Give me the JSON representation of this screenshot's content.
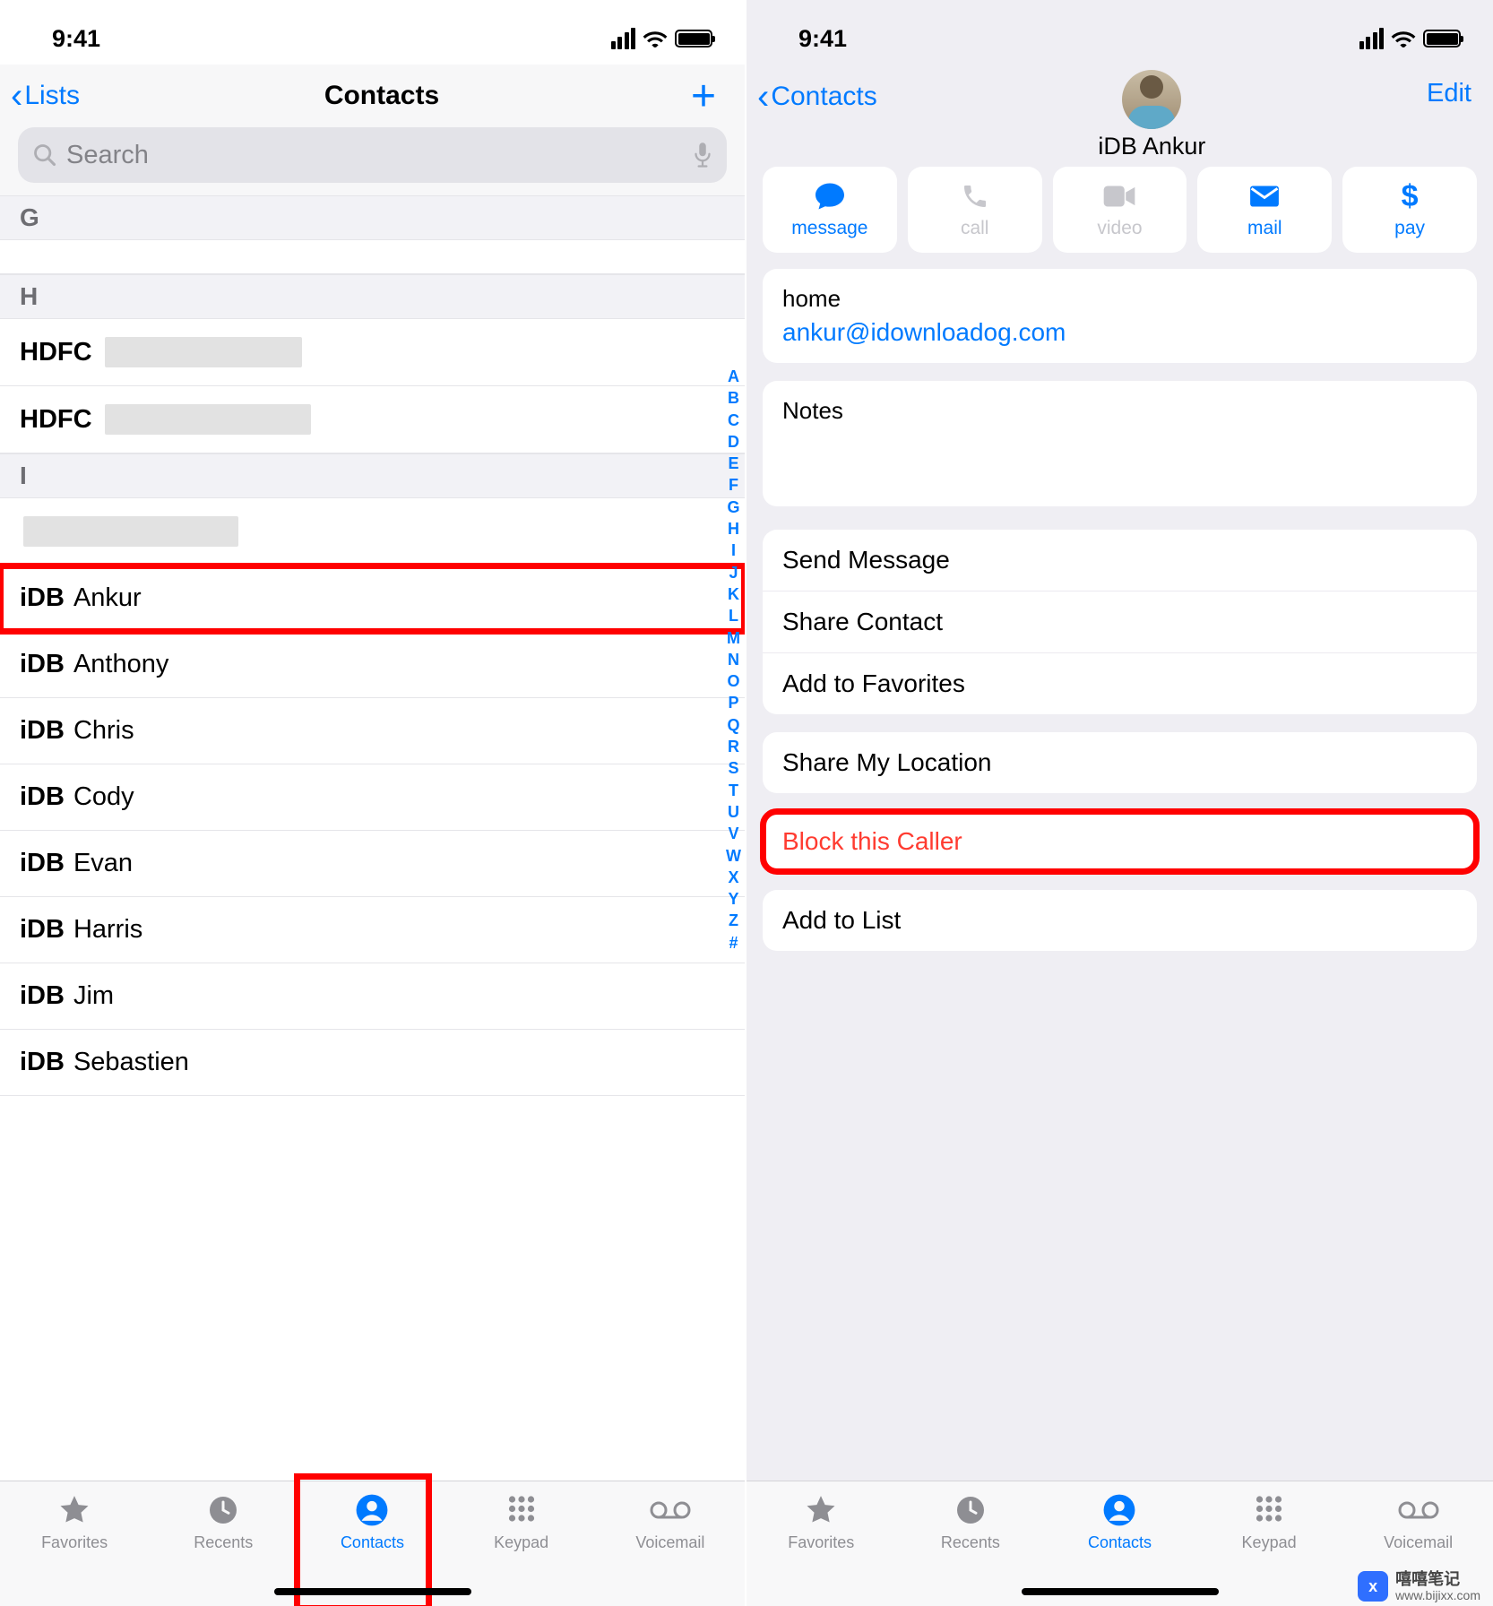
{
  "status": {
    "time": "9:41"
  },
  "left": {
    "back_label": "Lists",
    "title": "Contacts",
    "search_placeholder": "Search",
    "sections": {
      "g": "G",
      "h": "H",
      "i": "I"
    },
    "contacts": [
      {
        "bold": "HDFC",
        "rest": ""
      },
      {
        "bold": "HDFC",
        "rest": ""
      },
      {
        "bold": "iDB",
        "rest": "Ankur"
      },
      {
        "bold": "iDB",
        "rest": "Anthony"
      },
      {
        "bold": "iDB",
        "rest": "Chris"
      },
      {
        "bold": "iDB",
        "rest": "Cody"
      },
      {
        "bold": "iDB",
        "rest": "Evan"
      },
      {
        "bold": "iDB",
        "rest": "Harris"
      },
      {
        "bold": "iDB",
        "rest": "Jim"
      },
      {
        "bold": "iDB",
        "rest": "Sebastien"
      }
    ],
    "index_letters": [
      "A",
      "B",
      "C",
      "D",
      "E",
      "F",
      "G",
      "H",
      "I",
      "J",
      "K",
      "L",
      "M",
      "N",
      "O",
      "P",
      "Q",
      "R",
      "S",
      "T",
      "U",
      "V",
      "W",
      "X",
      "Y",
      "Z",
      "#"
    ]
  },
  "right": {
    "back_label": "Contacts",
    "edit_label": "Edit",
    "contact_name": "iDB Ankur",
    "actions": [
      {
        "key": "message",
        "label": "message",
        "enabled": true
      },
      {
        "key": "call",
        "label": "call",
        "enabled": false
      },
      {
        "key": "video",
        "label": "video",
        "enabled": false
      },
      {
        "key": "mail",
        "label": "mail",
        "enabled": true
      },
      {
        "key": "pay",
        "label": "pay",
        "enabled": true
      }
    ],
    "email_label": "home",
    "email_value": "ankur@idownloadog.com",
    "notes_label": "Notes",
    "options": {
      "send_message": "Send Message",
      "share_contact": "Share Contact",
      "add_to_favorites": "Add to Favorites",
      "share_location": "Share My Location",
      "block_caller": "Block this Caller",
      "add_to_list": "Add to List"
    }
  },
  "tabs": [
    {
      "key": "favorites",
      "label": "Favorites"
    },
    {
      "key": "recents",
      "label": "Recents"
    },
    {
      "key": "contacts",
      "label": "Contacts"
    },
    {
      "key": "keypad",
      "label": "Keypad"
    },
    {
      "key": "voicemail",
      "label": "Voicemail"
    }
  ],
  "watermark": {
    "brand": "嘻嘻笔记",
    "url": "www.bijixx.com"
  }
}
